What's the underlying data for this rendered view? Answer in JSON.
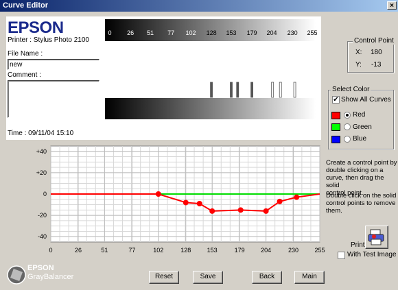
{
  "window": {
    "title": "Curve Editor",
    "close_glyph": "×"
  },
  "brand": {
    "logo": "EPSON",
    "printer": "Printer : Stylus Photo 2100"
  },
  "file_name": {
    "label": "File Name :",
    "value": "new"
  },
  "comment": {
    "label": "Comment :",
    "value": ""
  },
  "time": "Time : 09/11/04 15:10",
  "ruler": {
    "ticks": [
      "0",
      "26",
      "51",
      "77",
      "102",
      "128",
      "153",
      "179",
      "204",
      "230",
      "255"
    ]
  },
  "control_point": {
    "title": "Control Point",
    "x_label": "X:",
    "x_value": "180",
    "y_label": "Y:",
    "y_value": "-13"
  },
  "select_color": {
    "title": "Select Color",
    "show_all_label": "Show All Curves",
    "show_all_checked": true,
    "options": [
      {
        "label": "Red",
        "color": "#ff0000",
        "selected": true
      },
      {
        "label": "Green",
        "color": "#00ff00",
        "selected": false
      },
      {
        "label": "Blue",
        "color": "#0000ff",
        "selected": false
      }
    ]
  },
  "instructions": {
    "p1": [
      "Create a control point by",
      "double clicking on a",
      "curve, then drag the solid",
      "control point."
    ],
    "p2": [
      "Double click on the solid",
      "control points to remove",
      "them."
    ]
  },
  "print": {
    "label": "Print",
    "test_image_label": "With Test Image",
    "test_image_checked": false
  },
  "buttons": {
    "reset": "Reset",
    "save": "Save",
    "back": "Back",
    "main": "Main"
  },
  "footer_logo": {
    "line1": "EPSON",
    "line2": "GrayBalancer"
  },
  "chart_data": {
    "type": "line",
    "x_ticks": [
      0,
      26,
      51,
      77,
      102,
      128,
      153,
      179,
      204,
      230,
      255
    ],
    "y_ticks": [
      40,
      20,
      0,
      -20,
      -40
    ],
    "y_tick_labels": [
      "+40",
      "+20",
      "0",
      "-20",
      "-40"
    ],
    "xlim": [
      0,
      255
    ],
    "ylim": [
      -45,
      45
    ],
    "grid": true,
    "series": [
      {
        "color": "#00dd00",
        "points": [
          [
            0,
            0
          ],
          [
            255,
            0
          ]
        ],
        "markers": []
      },
      {
        "color": "#ff0000",
        "points": [
          [
            0,
            0
          ],
          [
            102,
            0
          ],
          [
            128,
            -8
          ],
          [
            141,
            -9
          ],
          [
            153,
            -16
          ],
          [
            180,
            -15
          ],
          [
            204,
            -16
          ],
          [
            217,
            -7
          ],
          [
            233,
            -3
          ],
          [
            255,
            0
          ]
        ],
        "markers": [
          [
            102,
            0
          ],
          [
            128,
            -8
          ],
          [
            141,
            -9
          ],
          [
            153,
            -16
          ],
          [
            180,
            -15
          ],
          [
            204,
            -16
          ],
          [
            217,
            -7
          ],
          [
            233,
            -3
          ]
        ]
      }
    ],
    "strip_markers": [
      128,
      153,
      161,
      179,
      205,
      215,
      233
    ]
  }
}
